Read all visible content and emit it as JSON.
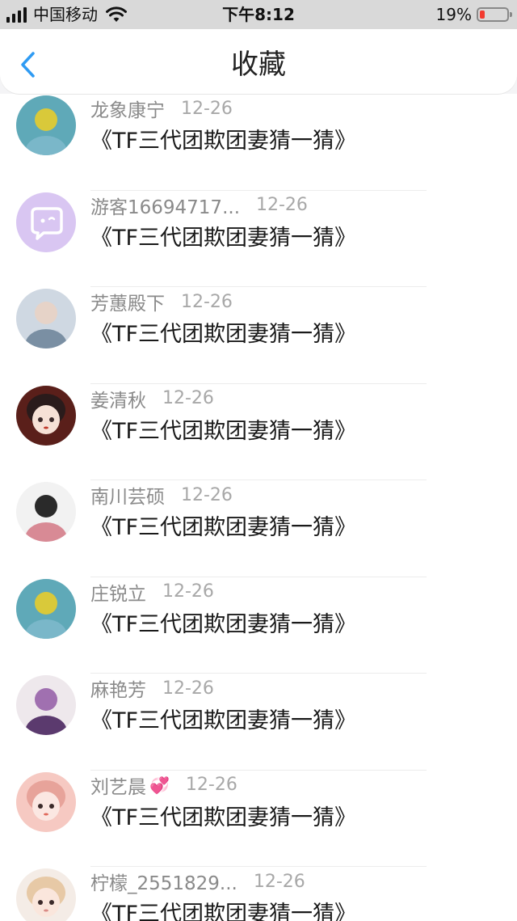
{
  "status_bar": {
    "carrier": "中国移动",
    "time": "下午8:12",
    "battery_percent": "19%",
    "battery_level": 0.19,
    "battery_color": "#f23b30",
    "icons": [
      "signal-icon",
      "wifi-icon",
      "battery-icon"
    ]
  },
  "nav": {
    "title": "收藏",
    "back_icon": "chevron-left-icon",
    "accent": "#2f9bf3"
  },
  "items": [
    {
      "name": "龙象康宁",
      "emoji": "",
      "date": "12-26",
      "title": "《TF三代团欺团妻猜一猜》",
      "avatar": "photo-avatar"
    },
    {
      "name": "游客16694717...",
      "emoji": "",
      "date": "12-26",
      "title": "《TF三代团欺团妻猜一猜》",
      "avatar": "default-chat-avatar"
    },
    {
      "name": "芳蕙殿下",
      "emoji": "",
      "date": "12-26",
      "title": "《TF三代团欺团妻猜一猜》",
      "avatar": "photo-avatar"
    },
    {
      "name": "姜清秋",
      "emoji": "",
      "date": "12-26",
      "title": "《TF三代团欺团妻猜一猜》",
      "avatar": "anime-avatar"
    },
    {
      "name": "南川芸硕",
      "emoji": "",
      "date": "12-26",
      "title": "《TF三代团欺团妻猜一猜》",
      "avatar": "photo-avatar"
    },
    {
      "name": "庄锐立",
      "emoji": "",
      "date": "12-26",
      "title": "《TF三代团欺团妻猜一猜》",
      "avatar": "photo-avatar"
    },
    {
      "name": "麻艳芳",
      "emoji": "",
      "date": "12-26",
      "title": "《TF三代团欺团妻猜一猜》",
      "avatar": "photo-avatar"
    },
    {
      "name": "刘艺晨",
      "emoji": "💞",
      "date": "12-26",
      "title": "《TF三代团欺团妻猜一猜》",
      "avatar": "anime-avatar"
    },
    {
      "name": "柠檬_2551829...",
      "emoji": "",
      "date": "12-26",
      "title": "《TF三代团欺团妻猜一猜》",
      "avatar": "anime-avatar"
    }
  ]
}
